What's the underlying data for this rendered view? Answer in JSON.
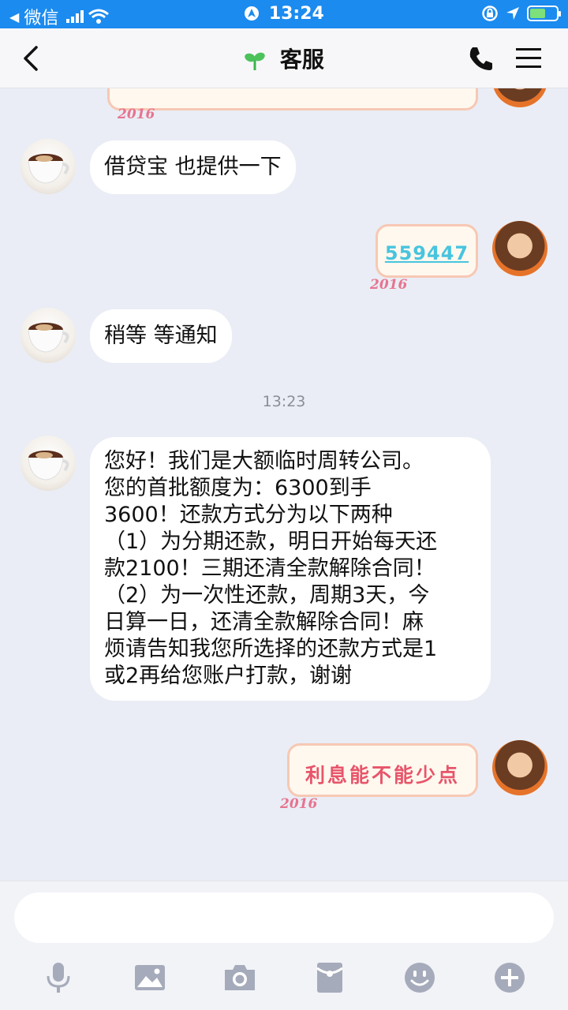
{
  "status_bar": {
    "carrier": "微信",
    "time": "13:24"
  },
  "nav": {
    "title": "客服"
  },
  "messages": [
    {
      "side": "left",
      "text": "借贷宝 也提供一下"
    },
    {
      "side": "right",
      "type": "sticker",
      "text": "559447"
    },
    {
      "side": "left",
      "text": "稍等 等通知"
    },
    {
      "type": "timestamp",
      "text": "13:23"
    },
    {
      "side": "left",
      "lines": [
        "您好！我们是大额临时周转公司。",
        "您的首批额度为：6300到手",
        "3600！还款方式分为以下两种",
        "（1）为分期还款，明日开始每天还",
        "款2100！三期还清全款解除合同！",
        "（2）为一次性还款，周期3天，今",
        "日算一日，还清全款解除合同！麻",
        "烦请告知我您所选择的还款方式是1",
        "或2再给您账户打款，谢谢"
      ]
    },
    {
      "side": "right",
      "type": "sticker",
      "text": "利息能不能少点"
    }
  ],
  "sticker_deco": "2016",
  "colors": {
    "status_bar": "#1b8bef",
    "chat_bg": "#eaedf5",
    "toolbar_icon": "#a6abbb",
    "sticker_blue": "#48c4de",
    "sticker_red": "#e7556a"
  },
  "toolbar_icons": [
    "microphone-icon",
    "image-icon",
    "camera-icon",
    "red-packet-icon",
    "emoji-icon",
    "plus-icon"
  ]
}
